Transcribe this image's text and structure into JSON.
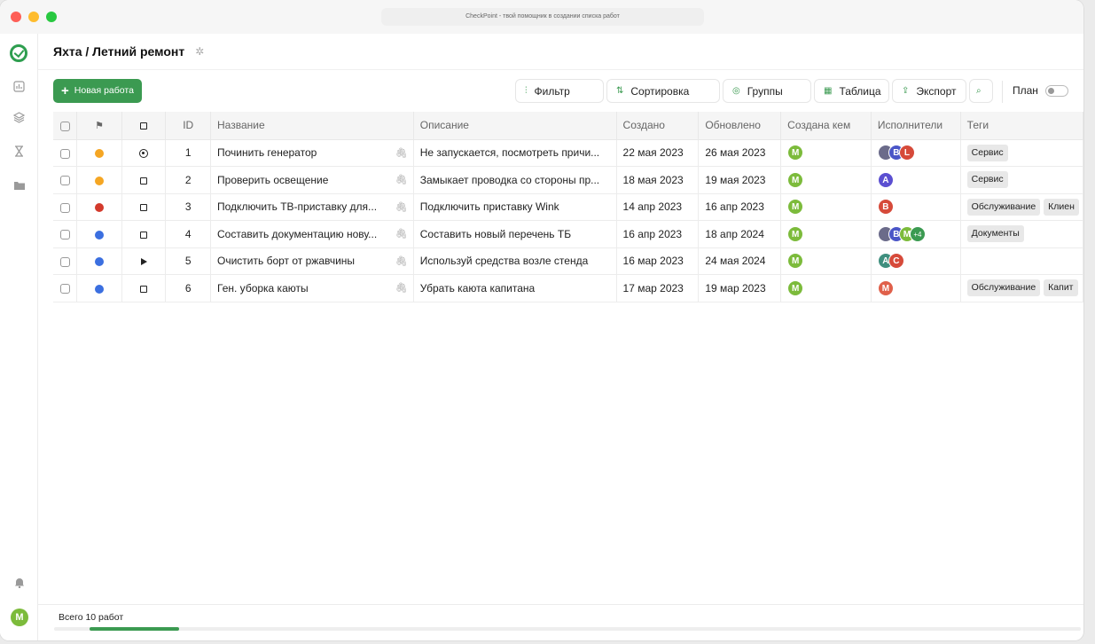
{
  "window": {
    "title": "CheckPoint - твой помощник в создании списка работ"
  },
  "header": {
    "title": "Яхта / Летний ремонт"
  },
  "toolbar": {
    "new_label": "Новая работа",
    "filter_label": "Фильтр",
    "sort_label": "Сортировка",
    "groups_label": "Группы",
    "table_label": "Таблица",
    "export_label": "Экспорт",
    "plan_label": "План"
  },
  "columns": [
    "ID",
    "Название",
    "Описание",
    "Создано",
    "Обновлено",
    "Создана кем",
    "Исполнители",
    "Теги"
  ],
  "rows": [
    {
      "flag": "#f5a623",
      "status": "target",
      "id": "1",
      "name": "Починить генератор",
      "desc": "Не запускается, посмотреть причи...",
      "created": "22 мая 2023",
      "updated": "26 мая 2023",
      "creator": "M",
      "assignees": [
        {
          "l": "",
          "c": "#6b6b8a"
        },
        {
          "l": "B",
          "c": "#4a55c7"
        },
        {
          "l": "L",
          "c": "#d64a3a"
        }
      ],
      "tags": [
        "Сервис"
      ]
    },
    {
      "flag": "#f5a623",
      "status": "square",
      "id": "2",
      "name": "Проверить освещение",
      "desc": "Замыкает проводка со стороны пр...",
      "created": "18 мая 2023",
      "updated": "19 мая 2023",
      "creator": "M",
      "assignees": [
        {
          "l": "A",
          "c": "#5b4fd1"
        }
      ],
      "tags": [
        "Сервис"
      ]
    },
    {
      "flag": "#d33a2c",
      "status": "square",
      "id": "3",
      "name": "Подключить ТВ-приставку для...",
      "desc": "Подключить приставку Wink",
      "created": "14 апр 2023",
      "updated": "16 апр 2023",
      "creator": "M",
      "assignees": [
        {
          "l": "B",
          "c": "#d64a3a"
        }
      ],
      "tags": [
        "Обслуживание",
        "Клиен"
      ]
    },
    {
      "flag": "#3b6fe0",
      "status": "square",
      "id": "4",
      "name": "Составить документацию нову...",
      "desc": "Составить новый перечень ТБ",
      "created": "16 апр 2023",
      "updated": "18 апр 2024",
      "creator": "M",
      "assignees": [
        {
          "l": "",
          "c": "#6b6b8a"
        },
        {
          "l": "B",
          "c": "#4a55c7"
        },
        {
          "l": "M",
          "c": "#7cbb3b"
        },
        {
          "l": "+4",
          "c": "#3b9a51"
        }
      ],
      "tags": [
        "Документы"
      ]
    },
    {
      "flag": "#3b6fe0",
      "status": "play",
      "id": "5",
      "name": "Очистить борт от ржавчины",
      "desc": "Используй средства возле стенда",
      "created": "16 мар 2023",
      "updated": "24 мая 2024",
      "creator": "M",
      "assignees": [
        {
          "l": "A",
          "c": "#3f8f7e"
        },
        {
          "l": "C",
          "c": "#d64a3a"
        }
      ],
      "tags": []
    },
    {
      "flag": "#3b6fe0",
      "status": "square",
      "id": "6",
      "name": "Ген. уборка каюты",
      "desc": "Убрать каюта капитана",
      "created": "17 мар 2023",
      "updated": "19 мар 2023",
      "creator": "M",
      "assignees": [
        {
          "l": "M",
          "c": "#e0604a"
        }
      ],
      "tags": [
        "Обслуживание",
        "Капит"
      ]
    }
  ],
  "footer": {
    "total": "Всего 10 работ"
  },
  "user": {
    "initial": "M"
  },
  "colors": {
    "accent": "#3b9a51"
  },
  "icons": [
    "check-logo-icon",
    "chart-icon",
    "layers-icon",
    "hourglass-icon",
    "folder-icon",
    "bell-icon",
    "gear-icon",
    "paperclip-icon",
    "flag-icon"
  ]
}
